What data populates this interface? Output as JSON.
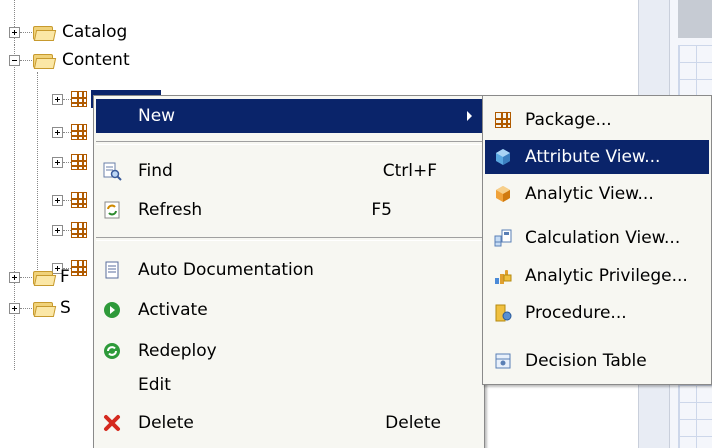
{
  "tree": {
    "catalog_label": "Catalog",
    "content_label": "Content",
    "partial_label_f": "F",
    "partial_label_s": "S"
  },
  "context_menu": {
    "new_label": "New",
    "find_label": "Find",
    "find_shortcut": "Ctrl+F",
    "refresh_label": "Refresh",
    "refresh_shortcut": "F5",
    "auto_doc_label": "Auto Documentation",
    "activate_label": "Activate",
    "redeploy_label": "Redeploy",
    "edit_label": "Edit",
    "delete_label": "Delete",
    "delete_shortcut": "Delete"
  },
  "submenu": {
    "package_label": "Package...",
    "attribute_view_label": "Attribute View...",
    "analytic_view_label": "Analytic View...",
    "calculation_view_label": "Calculation View...",
    "analytic_privilege_label": "Analytic Privilege...",
    "procedure_label": "Procedure...",
    "decision_table_label": "Decision Table"
  },
  "colors": {
    "selection": "#0a246a",
    "menu_background": "#f7f7f2"
  }
}
